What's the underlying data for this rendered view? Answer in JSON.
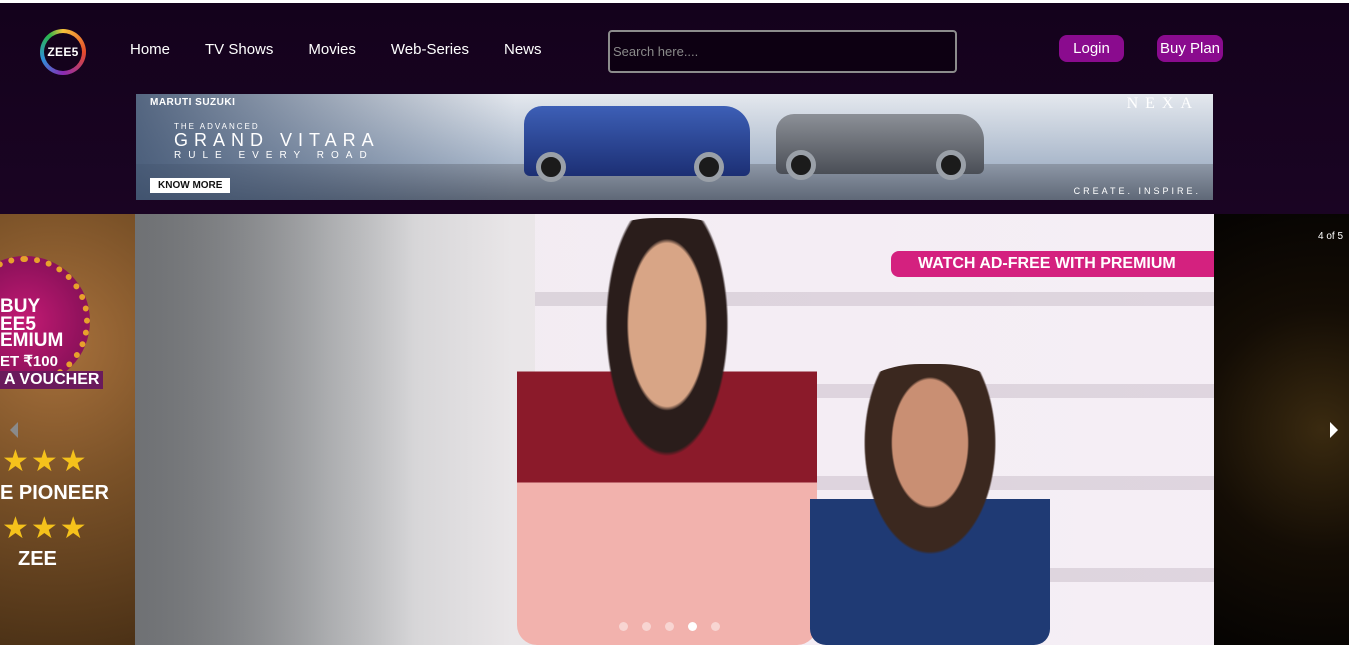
{
  "header": {
    "logo_text": "ZEE5",
    "nav": [
      "Home",
      "TV Shows",
      "Movies",
      "Web-Series",
      "News"
    ],
    "search_placeholder": "Search here....",
    "login_label": "Login",
    "buy_plan_label": "Buy Plan"
  },
  "ad": {
    "brand": "MARUTI SUZUKI",
    "eyebrow": "THE ADVANCED",
    "headline": "GRAND VITARA",
    "tagline": "RULE EVERY ROAD",
    "cta": "KNOW MORE",
    "nexa": "NEXA",
    "tag2": "CREATE. INSPIRE."
  },
  "carousel": {
    "counter": "4 of 5",
    "total": 5,
    "active_index": 4,
    "premium_tag": "WATCH AD-FREE WITH PREMIUM",
    "prev_slide": {
      "promo_lines": [
        "BUY",
        "EE5",
        "EMIUM",
        "ET ₹100",
        "A VOUCHER"
      ],
      "stars_top": "★★★",
      "pioneer": "E PIONEER",
      "stars_bottom": "★★★",
      "zee": "ZEE"
    }
  },
  "colors": {
    "header_bg": "#14021c",
    "button_bg": "#8a0b8e",
    "premium_tag": "#d4217f"
  }
}
